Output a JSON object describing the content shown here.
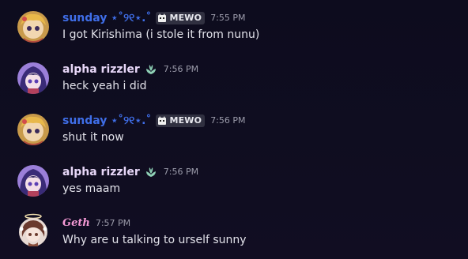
{
  "colors": {
    "background": "#0f0d20",
    "sunday_name": "#3f6ee8",
    "alpha_name": "#e7d7f8",
    "geth_name": "#f59ad6",
    "timestamp": "#9c9cab",
    "tag_bg": "#303040",
    "role_icon": "#8fd1b6"
  },
  "messages": [
    {
      "author": "sunday",
      "author_suffix": "⋆˚୨୧⋆.˚",
      "tag": "MEWO",
      "tag_icon": "cat-icon",
      "timestamp": "7:55 PM",
      "text": "I got Kirishima (i stole it from nunu)"
    },
    {
      "author": "alpha rizzler",
      "role_icon": "leaf-icon",
      "timestamp": "7:56 PM",
      "text": "heck yeah i did"
    },
    {
      "author": "sunday",
      "author_suffix": "⋆˚୨୧⋆.˚",
      "tag": "MEWO",
      "tag_icon": "cat-icon",
      "timestamp": "7:56 PM",
      "text": "shut it now"
    },
    {
      "author": "alpha rizzler",
      "role_icon": "leaf-icon",
      "timestamp": "7:56 PM",
      "text": "yes maam"
    },
    {
      "author": "Geth",
      "timestamp": "7:57 PM",
      "text": "Why are u talking to urself sunny"
    }
  ]
}
